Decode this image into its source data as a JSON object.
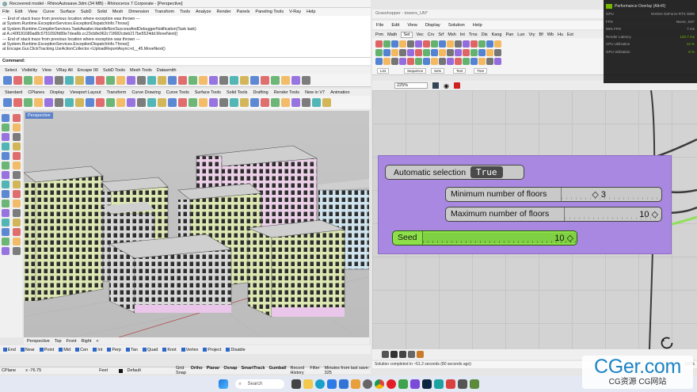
{
  "rhino": {
    "title": "Recovered model - RhinoAutosave.3dm (34 MB) - Rhinoceros 7 Corporate - [Perspective]",
    "menu": [
      "File",
      "Edit",
      "View",
      "Curve",
      "Surface",
      "SubD",
      "Solid",
      "Mesh",
      "Dimension",
      "Transform",
      "Tools",
      "Analyze",
      "Render",
      "Panels",
      "Paneling Tools",
      "V-Ray",
      "Help"
    ],
    "command_history": [
      "--- End of stack trace from previous location where exception was thrown ---",
      "at System.Runtime.ExceptionServices.ExceptionDispatchInfo.Throw()",
      "at System.Runtime.CompilerServices.TaskAwaiter.HandleNonSuccessAndDebuggerNotification(Task task)",
      "at A.c40f181680ad8c5751092fd89e7dea6b.cc23cb8e962c71f682cdeb217be5524dd.MoveNext()",
      "--- End of stack trace from previous location where exception was thrown ---",
      "at System.Runtime.ExceptionServices.ExceptionDispatchInfo.Throw()",
      "at Encape.Gui.ClickTracking.UsrActionCollector.<UploadReportAsync>d__45.MoveNext()"
    ],
    "command_label": "Command:",
    "toolbar_tabs_1": [
      "Select",
      "Visibility",
      "View",
      "VRay All",
      "Encape 00",
      "SubD Tools",
      "Mesh Tools",
      "Datasmith"
    ],
    "toolbar_tabs_2": [
      "Standard",
      "CPlanes",
      "Display",
      "Viewport Layout",
      "Transform",
      "Curve Drawing",
      "Curve Tools",
      "Surface Tools",
      "Solid Tools",
      "Drafting",
      "Render Tools",
      "New in V7",
      "Animation"
    ],
    "viewport_label": "Perspective",
    "view_tabs": [
      "Perspective",
      "Top",
      "Front",
      "Right",
      "+"
    ],
    "osnaps": [
      "End",
      "Near",
      "Point",
      "Mid",
      "Cen",
      "Int",
      "Perp",
      "Tan",
      "Quad",
      "Knot",
      "Vertex",
      "Project",
      "Disable"
    ],
    "status": {
      "cplane": "CPlane",
      "x": "x -76.75",
      "units": "Feet",
      "layer": "Default",
      "toggles": [
        "Grid Snap",
        "Ortho",
        "Planar",
        "Osnap",
        "SmartTrack",
        "Gumball",
        "Record History",
        "Filter"
      ],
      "save_msg": "Minutes from last save: 325"
    }
  },
  "grasshopper": {
    "title": "Grasshopper - towers_UN*",
    "menu": [
      "File",
      "Edit",
      "View",
      "Display",
      "Solution",
      "Help"
    ],
    "tabs": [
      "Prm",
      "Math",
      "Set",
      "Vec",
      "Crv",
      "Srf",
      "Msh",
      "Int",
      "Trns",
      "Dis",
      "Kang",
      "Pan",
      "Lun",
      "Vry",
      "Bf",
      "Wb",
      "Hu",
      "Ext"
    ],
    "active_tab": "Set",
    "ribbon_groups": [
      "List",
      "Sequence",
      "Sets",
      "Text",
      "Tree"
    ],
    "zoom": "225%",
    "nodes": {
      "auto_label": "Automatic selection",
      "auto_value": "True",
      "min_label": "Minimum number of floors",
      "min_value": "3",
      "max_label": "Maximum number of floors",
      "max_value": "10",
      "seed_label": "Seed",
      "seed_value": "10"
    },
    "status": "Solution completed in ~61.2 seconds (80 seconds ago)",
    "status_pct": "100%"
  },
  "perf_overlay": {
    "title": "Performance Overlay (Alt+R)",
    "rows": [
      {
        "k": "GPU",
        "v": "NVIDIA GeForce RTX 3090"
      },
      {
        "k": "FPS",
        "v": "Nvenc, DX*"
      },
      {
        "k": "99% FPS",
        "v": "7 ms"
      },
      {
        "k": "Render Latency",
        "v": "120.7 ms"
      },
      {
        "k": "CPU Utilization",
        "v": "12 %"
      },
      {
        "k": "GPU Utilization",
        "v": "8 %"
      }
    ]
  },
  "taskbar": {
    "search_placeholder": "Search"
  },
  "watermark": {
    "main": "CGer.com",
    "sub": "CG资源 CG网站"
  },
  "colors": {
    "group": "#a988e2",
    "wire_green": "#8fe05a",
    "seed": "#8ee04a",
    "viewport_bg": "#c2c2c2"
  }
}
